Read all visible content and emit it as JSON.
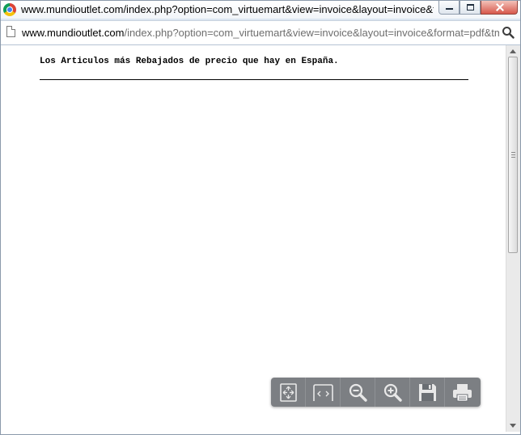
{
  "window": {
    "title": "www.mundioutlet.com/index.php?option=com_virtuemart&view=invoice&layout=invoice&for..."
  },
  "address_bar": {
    "host": "www.mundioutlet.com",
    "path": "/index.php?option=com_virtuemart&view=invoice&layout=invoice&format=pdf&tmpl"
  },
  "document": {
    "heading": "Los Articulos más Rebajados de precio que hay en España."
  },
  "pdf_toolbar": {
    "buttons": [
      "fit-page-icon",
      "fit-width-icon",
      "zoom-out-icon",
      "zoom-in-icon",
      "save-icon",
      "print-icon"
    ]
  },
  "colors": {
    "toolbar_bg": "#5f6368",
    "scrollbar_bg": "#eaeaea",
    "frame": "#dce6f2"
  }
}
